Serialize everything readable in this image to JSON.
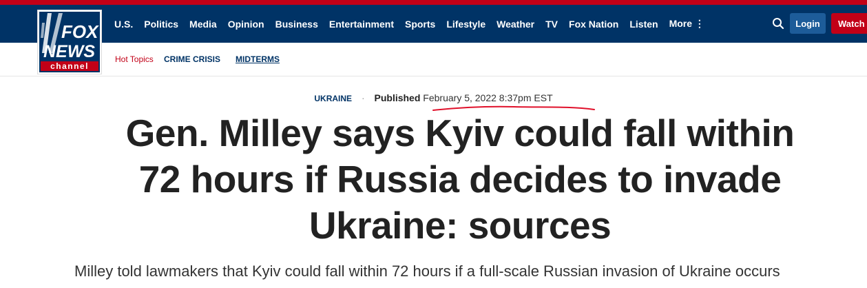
{
  "logo": {
    "line1": "FOX",
    "line2": "NEWS",
    "line3": "channel"
  },
  "nav": {
    "items": [
      "U.S.",
      "Politics",
      "Media",
      "Opinion",
      "Business",
      "Entertainment",
      "Sports",
      "Lifestyle",
      "Weather",
      "TV",
      "Fox Nation",
      "Listen"
    ],
    "more_label": "More ⋮",
    "search_icon": "search-icon",
    "login_label": "Login",
    "watch_label": "Watch TV"
  },
  "subnav": {
    "hot_topics_label": "Hot Topics",
    "topics": [
      "CRIME CRISIS",
      "MIDTERMS"
    ]
  },
  "article": {
    "category": "UKRAINE",
    "separator": "·",
    "published_label": "Published",
    "published_date": "February 5, 2022 8:37pm EST",
    "headline": "Gen. Milley says Kyiv could fall within 72 hours if Russia decides to invade Ukraine: sources",
    "subhead": "Milley told lawmakers that Kyiv could fall within 72 hours if a full-scale Russian invasion of Ukraine occurs"
  },
  "colors": {
    "brand_navy": "#003366",
    "brand_red": "#c20017",
    "login_blue": "#1d5c99",
    "annotation_red": "#e0102a"
  }
}
